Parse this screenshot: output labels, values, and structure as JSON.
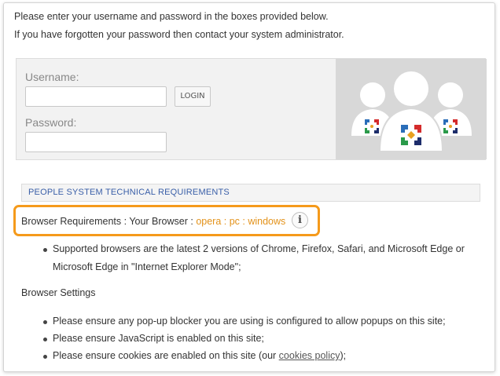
{
  "intro": {
    "line1": "Please enter your username and password in the boxes provided below.",
    "line2": "If you have forgotten your password then contact your system administrator."
  },
  "login": {
    "username_label": "Username:",
    "username_value": "",
    "password_label": "Password:",
    "password_value": "",
    "login_button": "LOGIN"
  },
  "requirements": {
    "header": "PEOPLE SYSTEM TECHNICAL REQUIREMENTS",
    "browser_label": "Browser Requirements : Your Browser : ",
    "browser_value": "opera : pc : windows",
    "info_icon": "i",
    "supported_line1": "Supported browsers are the latest 2 versions of Chrome, Firefox, Safari, and Microsoft Edge or",
    "supported_line2": "Microsoft Edge in \"Internet Explorer Mode\";"
  },
  "settings": {
    "title": "Browser Settings",
    "popup": "Please ensure any pop-up blocker you are using is configured to allow popups on this site;",
    "javascript": "Please ensure JavaScript is enabled on this site;",
    "cookies_prefix": "Please ensure cookies are enabled on this site (our ",
    "cookies_link": "cookies policy",
    "cookies_suffix": ");"
  },
  "colors": {
    "highlight": "#f59a1b",
    "header_text": "#3a5fa8",
    "browser_value": "#e3921a"
  }
}
